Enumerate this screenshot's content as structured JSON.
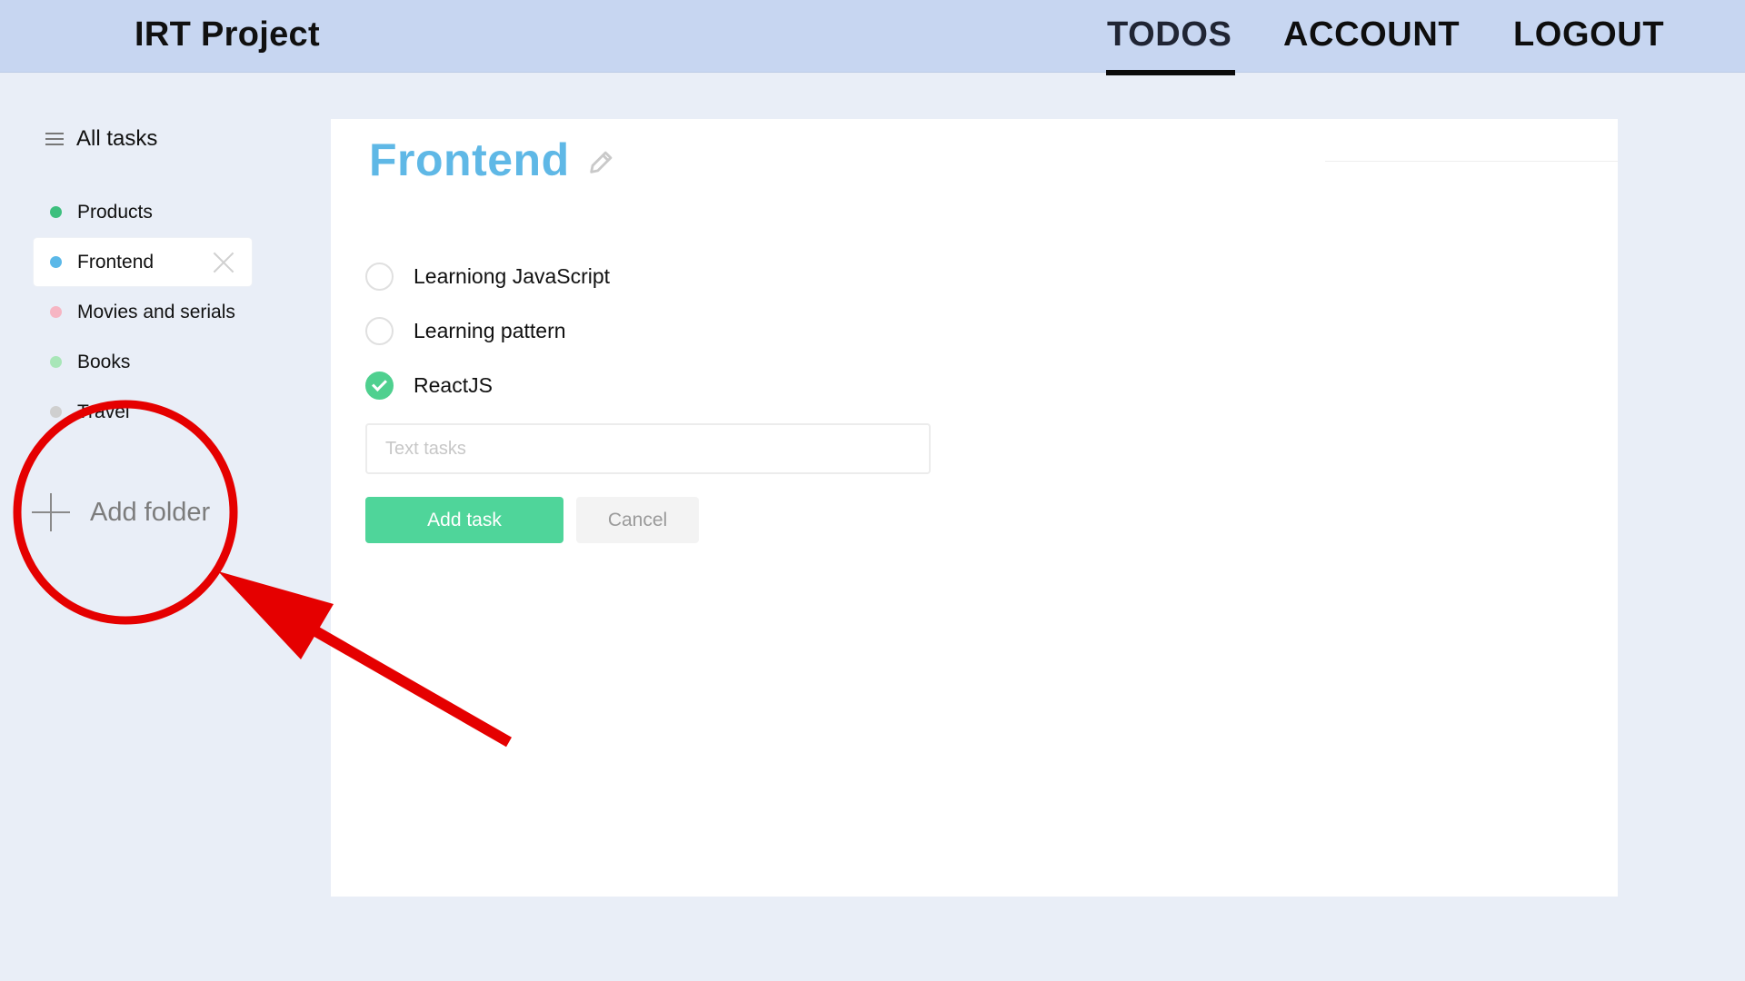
{
  "header": {
    "app_title": "IRT Project",
    "nav": [
      {
        "label": "TODOS",
        "active": true
      },
      {
        "label": "ACCOUNT",
        "active": false
      },
      {
        "label": "LOGOUT",
        "active": false
      }
    ]
  },
  "sidebar": {
    "all_tasks_label": "All tasks",
    "folders": [
      {
        "label": "Products",
        "color": "#3dbf7e",
        "active": false
      },
      {
        "label": "Frontend",
        "color": "#5bb8e8",
        "active": true
      },
      {
        "label": "Movies and serials",
        "color": "#f6b5c3",
        "active": false
      },
      {
        "label": "Books",
        "color": "#a8e6b8",
        "active": false
      },
      {
        "label": "Travel",
        "color": "#cfcfcf",
        "active": false
      }
    ],
    "add_folder_label": "Add folder"
  },
  "main": {
    "title": "Frontend",
    "title_color": "#5fb8e6",
    "tasks": [
      {
        "label": "Learniong JavaScript",
        "done": false
      },
      {
        "label": "Learning pattern",
        "done": false
      },
      {
        "label": "ReactJS",
        "done": true
      }
    ],
    "input_placeholder": "Text tasks",
    "add_task_label": "Add task",
    "cancel_label": "Cancel"
  },
  "annotation": {
    "color": "#e50000"
  }
}
